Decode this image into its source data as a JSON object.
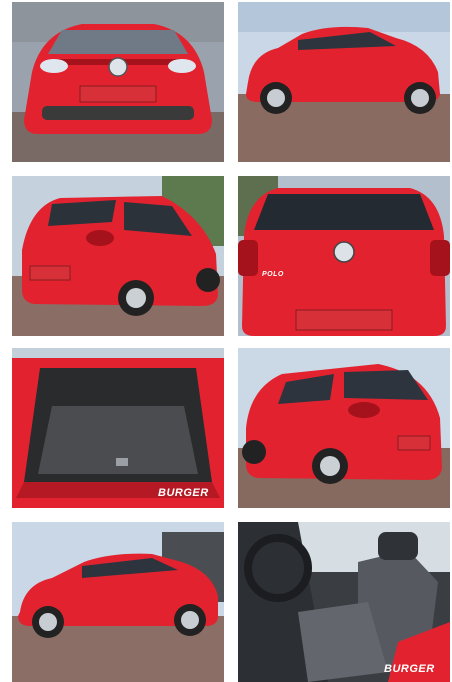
{
  "gallery": {
    "photos": [
      {
        "alt": "front view",
        "watermark": ""
      },
      {
        "alt": "side view",
        "watermark": ""
      },
      {
        "alt": "rear three-quarter view",
        "watermark": ""
      },
      {
        "alt": "rear view",
        "watermark": ""
      },
      {
        "alt": "open trunk",
        "watermark": "BURGER"
      },
      {
        "alt": "rear three-quarter view right",
        "watermark": ""
      },
      {
        "alt": "side view left",
        "watermark": ""
      },
      {
        "alt": "interior seats",
        "watermark": "BURGER"
      }
    ],
    "badges": {
      "model": "POLO"
    },
    "colors": {
      "car_red": "#e2232f",
      "dark_red": "#a5121b",
      "ground": "#8a6b62",
      "sky": "#c9d7e6"
    }
  }
}
